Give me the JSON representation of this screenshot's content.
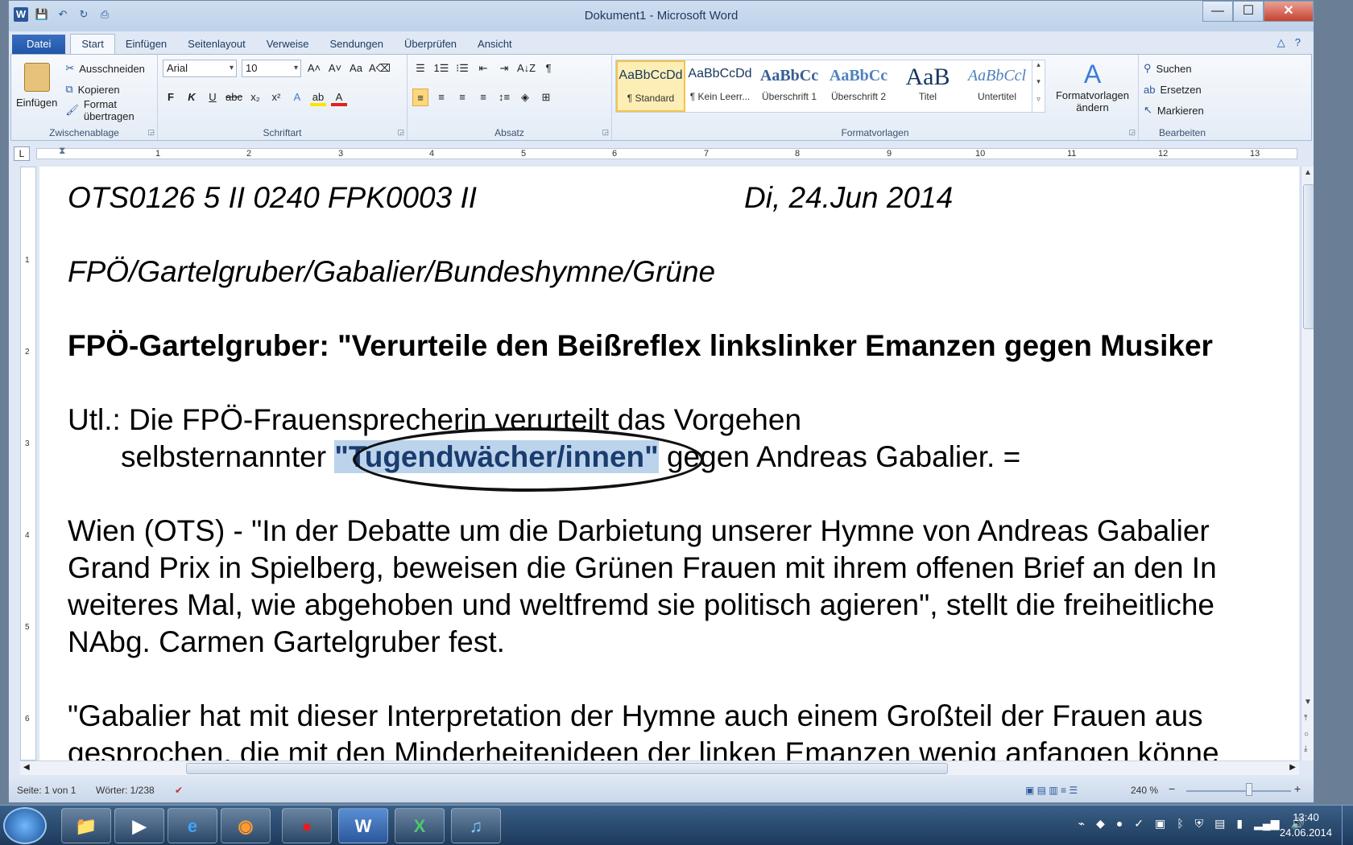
{
  "window": {
    "title": "Dokument1 - Microsoft Word"
  },
  "qat": {
    "word_icon": "W",
    "save": "💾",
    "undo": "↶",
    "redo": "↻",
    "print": "⎙"
  },
  "winbtns": {
    "minimize": "—",
    "maximize": "☐",
    "close": "✕"
  },
  "tabs": [
    "Datei",
    "Start",
    "Einfügen",
    "Seitenlayout",
    "Verweise",
    "Sendungen",
    "Überprüfen",
    "Ansicht"
  ],
  "ribbon": {
    "clipboard": {
      "name": "Zwischenablage",
      "paste": "Einfügen",
      "cut": "Ausschneiden",
      "copy": "Kopieren",
      "format_painter": "Format übertragen"
    },
    "font": {
      "name": "Schriftart",
      "family": "Arial",
      "size": "10",
      "grow": "A˄",
      "shrink": "A˅",
      "change_case": "Aa",
      "clear": "A⌫",
      "bold": "F",
      "italic": "K",
      "underline": "U",
      "strike": "abc",
      "sub": "x₂",
      "sup": "x²",
      "effects": "A",
      "highlight": "ab",
      "color": "A"
    },
    "paragraph": {
      "name": "Absatz",
      "bullets": "☰",
      "numbering": "1☰",
      "multilevel": "⁝☰",
      "decrease": "⇤",
      "increase": "⇥",
      "sort": "A↓Z",
      "pilcrow": "¶",
      "left": "≡",
      "center": "≡",
      "right": "≡",
      "justify": "≡",
      "spacing": "↕≡",
      "shading": "◈",
      "borders": "⊞"
    },
    "styles": {
      "name": "Formatvorlagen",
      "items": [
        {
          "preview": "AaBbCcDd",
          "label": "¶ Standard"
        },
        {
          "preview": "AaBbCcDd",
          "label": "¶ Kein Leerr..."
        },
        {
          "preview": "AaBbCc",
          "label": "Überschrift 1"
        },
        {
          "preview": "AaBbCc",
          "label": "Überschrift 2"
        },
        {
          "preview": "AaB",
          "label": "Titel"
        },
        {
          "preview": "AaBbCcl",
          "label": "Untertitel"
        }
      ],
      "change": "Formatvorlagen ändern"
    },
    "editing": {
      "name": "Bearbeiten",
      "find": "Suchen",
      "replace": "Ersetzen",
      "select": "Markieren"
    }
  },
  "ruler": {
    "tab_selector": "L",
    "numbers": [
      "1",
      "2",
      "3",
      "4",
      "5",
      "6",
      "7",
      "8",
      "9",
      "10",
      "11",
      "12",
      "13"
    ]
  },
  "vruler": {
    "numbers": [
      "1",
      "2",
      "3",
      "4",
      "5",
      "6"
    ]
  },
  "document": {
    "line1_left": "OTS0126 5 II 0240 FPK0003 II",
    "line1_right": "Di, 24.Jun 2014",
    "line2": "FPÖ/Gartelgruber/Gabalier/Bundeshymne/Grüne",
    "line3": "FPÖ-Gartelgruber: \"Verurteile den Beißreflex linkslinker Emanzen gegen Musiker",
    "line4": "Utl.: Die FPÖ-Frauensprecherin verurteilt das Vorgehen",
    "line5_a": "selbsternannter ",
    "line5_sel": "\"Tugendwächer/innen\"",
    "line5_b": " gegen Andreas Gabalier. =",
    "line6": "Wien (OTS) - \"In der Debatte um die Darbietung unserer Hymne von Andreas Gabalier",
    "line7": "Grand Prix in Spielberg, beweisen die Grünen Frauen mit ihrem offenen Brief an den In",
    "line8": "weiteres Mal, wie abgehoben und weltfremd sie politisch agieren\", stellt die freiheitliche",
    "line9": "NAbg. Carmen Gartelgruber fest.",
    "line10": "\"Gabalier hat mit dieser Interpretation der Hymne auch einem Großteil der Frauen aus",
    "line11": "gesprochen, die mit den Minderheitenideen der linken Emanzen wenig anfangen könne"
  },
  "status": {
    "page": "Seite: 1 von 1",
    "words": "Wörter: 1/238",
    "zoom": "240 %",
    "zoom_minus": "−",
    "zoom_plus": "+"
  },
  "taskbar": {
    "time": "13:40",
    "date": "24.06.2014"
  }
}
